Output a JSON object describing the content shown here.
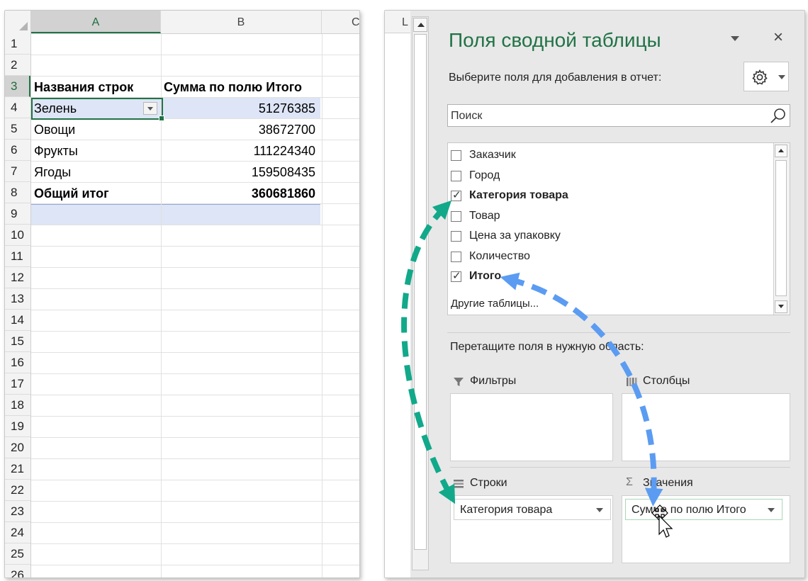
{
  "sheet": {
    "columns": [
      "A",
      "B",
      "C"
    ],
    "selected_column": "A",
    "rows": [
      {
        "num": "1",
        "a": "",
        "b": ""
      },
      {
        "num": "2",
        "a": "",
        "b": ""
      },
      {
        "num": "3",
        "a": "Названия строк",
        "b": "Сумма по полю Итого",
        "style": "header"
      },
      {
        "num": "4",
        "a": "Зелень",
        "b": "51276385"
      },
      {
        "num": "5",
        "a": "Овощи",
        "b": "38672700"
      },
      {
        "num": "6",
        "a": "Фрукты",
        "b": "111224340"
      },
      {
        "num": "7",
        "a": "Ягоды",
        "b": "159508435"
      },
      {
        "num": "8",
        "a": "Общий итог",
        "b": "360681860",
        "style": "total"
      },
      {
        "num": "9",
        "a": "",
        "b": ""
      },
      {
        "num": "10",
        "a": "",
        "b": ""
      },
      {
        "num": "11",
        "a": "",
        "b": ""
      },
      {
        "num": "12",
        "a": "",
        "b": ""
      },
      {
        "num": "13",
        "a": "",
        "b": ""
      },
      {
        "num": "14",
        "a": "",
        "b": ""
      },
      {
        "num": "15",
        "a": "",
        "b": ""
      },
      {
        "num": "16",
        "a": "",
        "b": ""
      },
      {
        "num": "17",
        "a": "",
        "b": ""
      },
      {
        "num": "18",
        "a": "",
        "b": ""
      },
      {
        "num": "19",
        "a": "",
        "b": ""
      },
      {
        "num": "20",
        "a": "",
        "b": ""
      },
      {
        "num": "21",
        "a": "",
        "b": ""
      },
      {
        "num": "22",
        "a": "",
        "b": ""
      },
      {
        "num": "23",
        "a": "",
        "b": ""
      },
      {
        "num": "24",
        "a": "",
        "b": ""
      },
      {
        "num": "25",
        "a": "",
        "b": ""
      },
      {
        "num": "26",
        "a": "",
        "b": ""
      }
    ]
  },
  "pane": {
    "left_column": "L",
    "title": "Поля сводной таблицы",
    "close": "×",
    "choose_label": "Выберите поля для добавления в отчет:",
    "gear_icon": "gear-icon",
    "search_placeholder": "Поиск",
    "fields": [
      {
        "label": "Заказчик",
        "checked": false
      },
      {
        "label": "Город",
        "checked": false
      },
      {
        "label": "Категория товара",
        "checked": true
      },
      {
        "label": "Товар",
        "checked": false
      },
      {
        "label": "Цена за упаковку",
        "checked": false
      },
      {
        "label": "Количество",
        "checked": false
      },
      {
        "label": "Итого",
        "checked": true
      }
    ],
    "other_tables": "Другие таблицы...",
    "drag_label": "Перетащите поля в нужную область:",
    "areas": {
      "filters": {
        "label": "Фильтры",
        "icon": "filter-icon"
      },
      "columns": {
        "label": "Столбцы",
        "icon": "columns-icon"
      },
      "rows": {
        "label": "Строки",
        "icon": "rows-icon",
        "item": "Категория товара"
      },
      "values": {
        "label": "Значения",
        "icon": "sigma-icon",
        "item": "Сумма по полю Итого"
      }
    }
  },
  "colors": {
    "excel_green": "#217346",
    "arrow_teal": "#11a98a",
    "arrow_blue": "#5b9cf2",
    "pivot_header_fill": "#dde5f6"
  }
}
